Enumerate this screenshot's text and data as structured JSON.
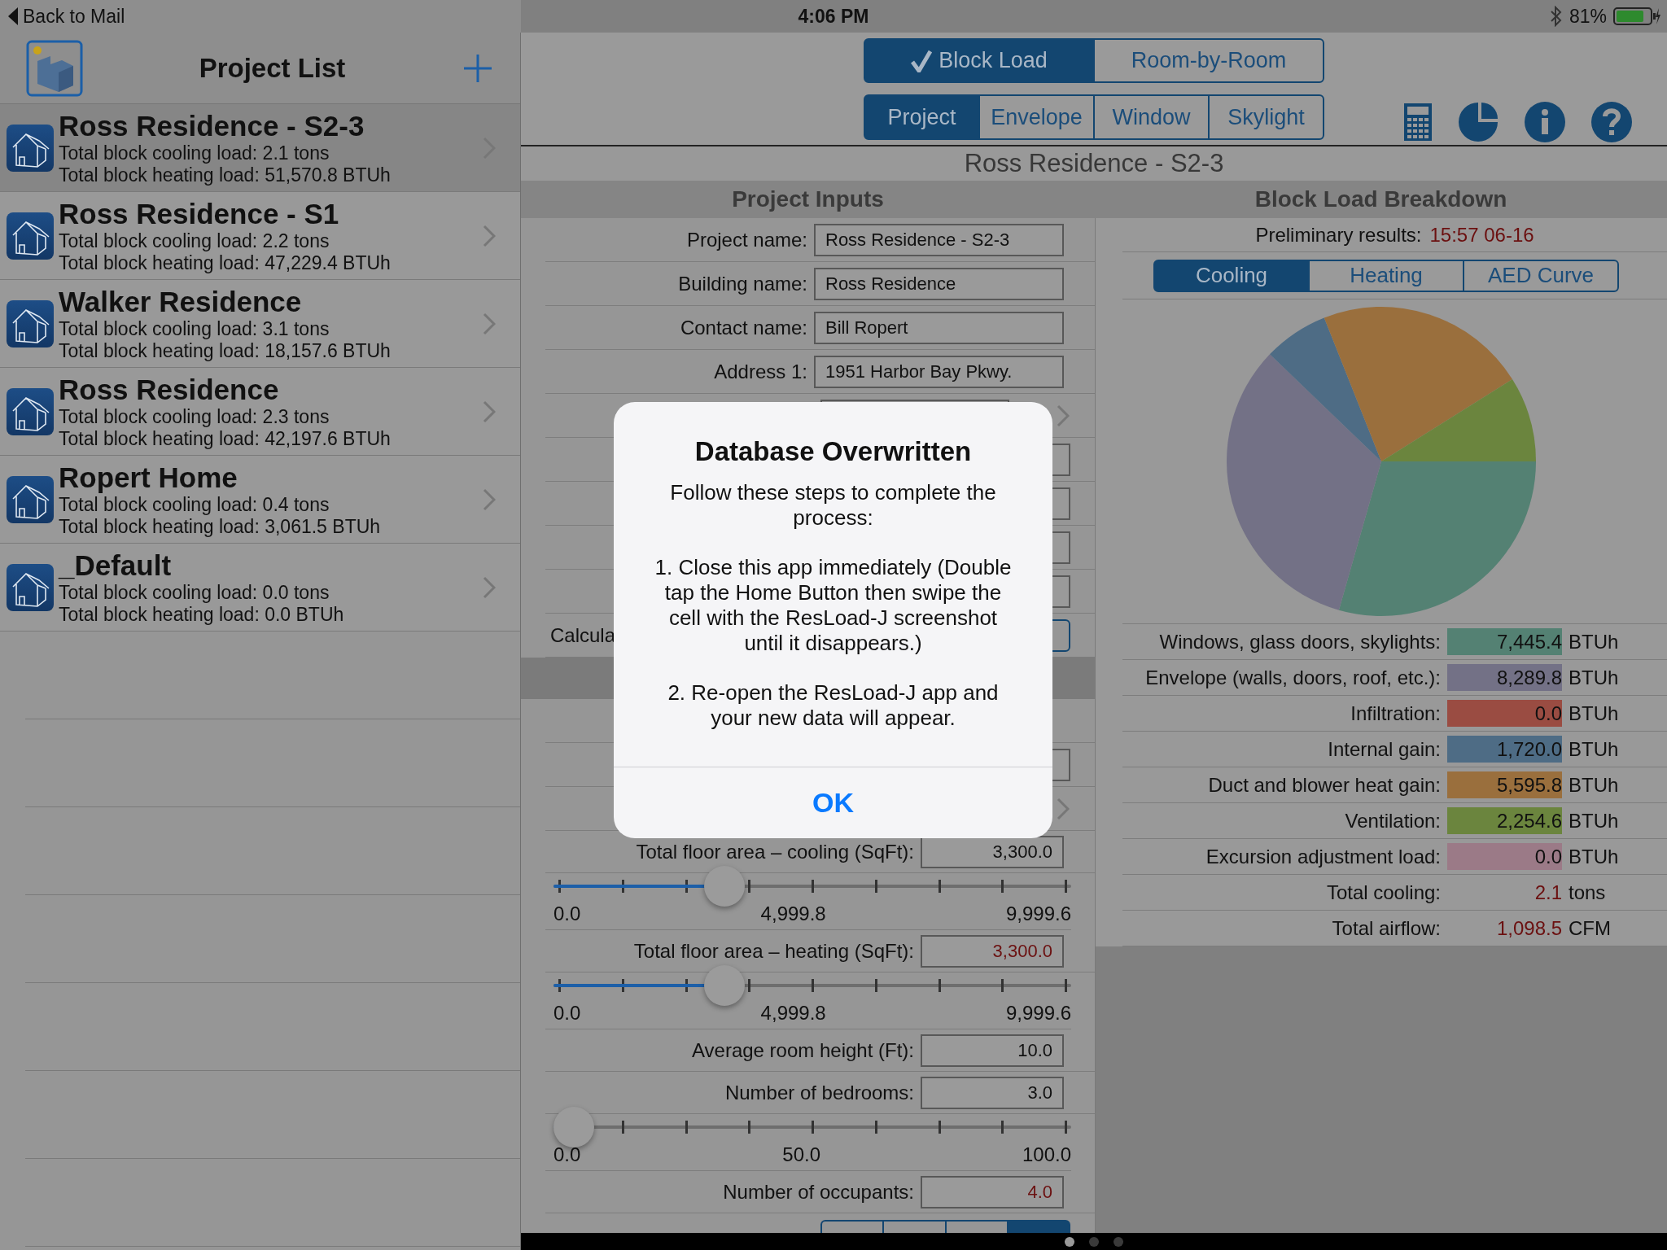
{
  "status_bar": {
    "back_label": "Back to Mail",
    "time": "4:06 PM",
    "battery": "81%"
  },
  "sidebar": {
    "title": "Project List",
    "projects": [
      {
        "name": "Ross Residence - S2-3",
        "cooling": "Total block cooling load: 2.1 tons",
        "heating": "Total block heating load: 51,570.8 BTUh",
        "selected": true
      },
      {
        "name": "Ross Residence - S1",
        "cooling": "Total block cooling load: 2.2 tons",
        "heating": "Total block heating load: 47,229.4 BTUh",
        "selected": false
      },
      {
        "name": "Walker Residence",
        "cooling": "Total block cooling load: 3.1 tons",
        "heating": "Total block heating load: 18,157.6 BTUh",
        "selected": false
      },
      {
        "name": "Ross Residence",
        "cooling": "Total block cooling load: 2.3 tons",
        "heating": "Total block heating load: 42,197.6 BTUh",
        "selected": false
      },
      {
        "name": "Ropert Home",
        "cooling": "Total block cooling load: 0.4 tons",
        "heating": "Total block heating load: 3,061.5 BTUh",
        "selected": false
      },
      {
        "name": "_Default",
        "cooling": "Total block cooling load: 0.0 tons",
        "heating": "Total block heating load: 0.0 BTUh",
        "selected": false
      }
    ]
  },
  "mode_tabs": [
    {
      "label": "Block Load",
      "selected": true
    },
    {
      "label": "Room-by-Room",
      "selected": false
    }
  ],
  "section_tabs": [
    {
      "label": "Project",
      "selected": true
    },
    {
      "label": "Envelope",
      "selected": false
    },
    {
      "label": "Window",
      "selected": false
    },
    {
      "label": "Skylight",
      "selected": false
    }
  ],
  "project_title": "Ross Residence - S2-3",
  "inputs": {
    "heading": "Project Inputs",
    "rows": [
      {
        "kind": "text",
        "label": "Project name:",
        "value": "Ross Residence - S2-3"
      },
      {
        "kind": "text",
        "label": "Building name:",
        "value": "Ross Residence"
      },
      {
        "kind": "text",
        "label": "Contact name:",
        "value": "Bill Ropert"
      },
      {
        "kind": "text",
        "label": "Address 1:",
        "value": "1951 Harbor Bay Pkwy."
      },
      {
        "kind": "picker"
      },
      {
        "kind": "field"
      },
      {
        "kind": "field"
      },
      {
        "kind": "field"
      },
      {
        "kind": "field"
      },
      {
        "kind": "button",
        "label": "Calcula"
      },
      {
        "kind": "section"
      },
      {
        "kind": "blank"
      },
      {
        "kind": "field"
      },
      {
        "kind": "chevron"
      },
      {
        "kind": "number",
        "label": "Total floor area – cooling (SqFt):",
        "value": "3,300.0",
        "flagged": false
      },
      {
        "kind": "slider",
        "level": 0.33,
        "min": "0.0",
        "mid": "4,999.8",
        "max": "9,999.6"
      },
      {
        "kind": "number",
        "label": "Total floor area – heating (SqFt):",
        "value": "3,300.0",
        "flagged": true
      },
      {
        "kind": "slider",
        "level": 0.33,
        "min": "0.0",
        "mid": "4,999.8",
        "max": "9,999.6"
      },
      {
        "kind": "number",
        "label": "Average room height (Ft):",
        "value": "10.0",
        "flagged": false
      },
      {
        "kind": "number",
        "label": "Number of bedrooms:",
        "value": "3.0",
        "flagged": false
      },
      {
        "kind": "slider",
        "level": 0.03,
        "min": "0.0",
        "mid": "50.0",
        "max": "100.0"
      },
      {
        "kind": "number",
        "label": "Number of occupants:",
        "value": "4.0",
        "flagged": true
      },
      {
        "kind": "segments",
        "segments": [
          {
            "selected": false
          },
          {
            "selected": false
          },
          {
            "selected": false
          },
          {
            "selected": true
          }
        ]
      }
    ]
  },
  "breakdown": {
    "heading": "Block Load Breakdown",
    "results_label": "Preliminary results:",
    "results_time": "15:57 06-16",
    "tabs": [
      {
        "label": "Cooling",
        "selected": true
      },
      {
        "label": "Heating",
        "selected": false
      },
      {
        "label": "AED Curve",
        "selected": false
      }
    ],
    "rows": [
      {
        "kind": "swatch",
        "label": "Windows, glass doors, skylights:",
        "value": "7,445.4",
        "unit": "BTUh",
        "color": "#548173"
      },
      {
        "kind": "swatch",
        "label": "Envelope (walls, doors, roof, etc.):",
        "value": "8,289.8",
        "unit": "BTUh",
        "color": "#737186"
      },
      {
        "kind": "swatch",
        "label": "Infiltration:",
        "value": "0.0",
        "unit": "BTUh",
        "color": "#9a4c42"
      },
      {
        "kind": "swatch",
        "label": "Internal gain:",
        "value": "1,720.0",
        "unit": "BTUh",
        "color": "#4e6c85"
      },
      {
        "kind": "swatch",
        "label": "Duct and blower heat gain:",
        "value": "5,595.8",
        "unit": "BTUh",
        "color": "#9a6f3d"
      },
      {
        "kind": "swatch",
        "label": "Ventilation:",
        "value": "2,254.6",
        "unit": "BTUh",
        "color": "#6b853e"
      },
      {
        "kind": "swatch",
        "label": "Excursion adjustment load:",
        "value": "0.0",
        "unit": "BTUh",
        "color": "#9b7a87"
      },
      {
        "kind": "total",
        "label": "Total cooling:",
        "value": "2.1",
        "unit": "tons"
      },
      {
        "kind": "total",
        "label": "Total airflow:",
        "value": "1,098.5",
        "unit": "CFM"
      }
    ]
  },
  "alert": {
    "title": "Database Overwritten",
    "paragraphs": [
      "Follow these steps to complete the process:",
      "1. Close this app immediately (Double tap the Home Button then swipe the cell with the ResLoad-J screenshot until it disappears.)",
      "2. Re-open the ResLoad-J app and your new data will appear."
    ],
    "button": "OK"
  },
  "page_dots": [
    {
      "selected": true
    },
    {
      "selected": false
    },
    {
      "selected": false
    }
  ]
}
